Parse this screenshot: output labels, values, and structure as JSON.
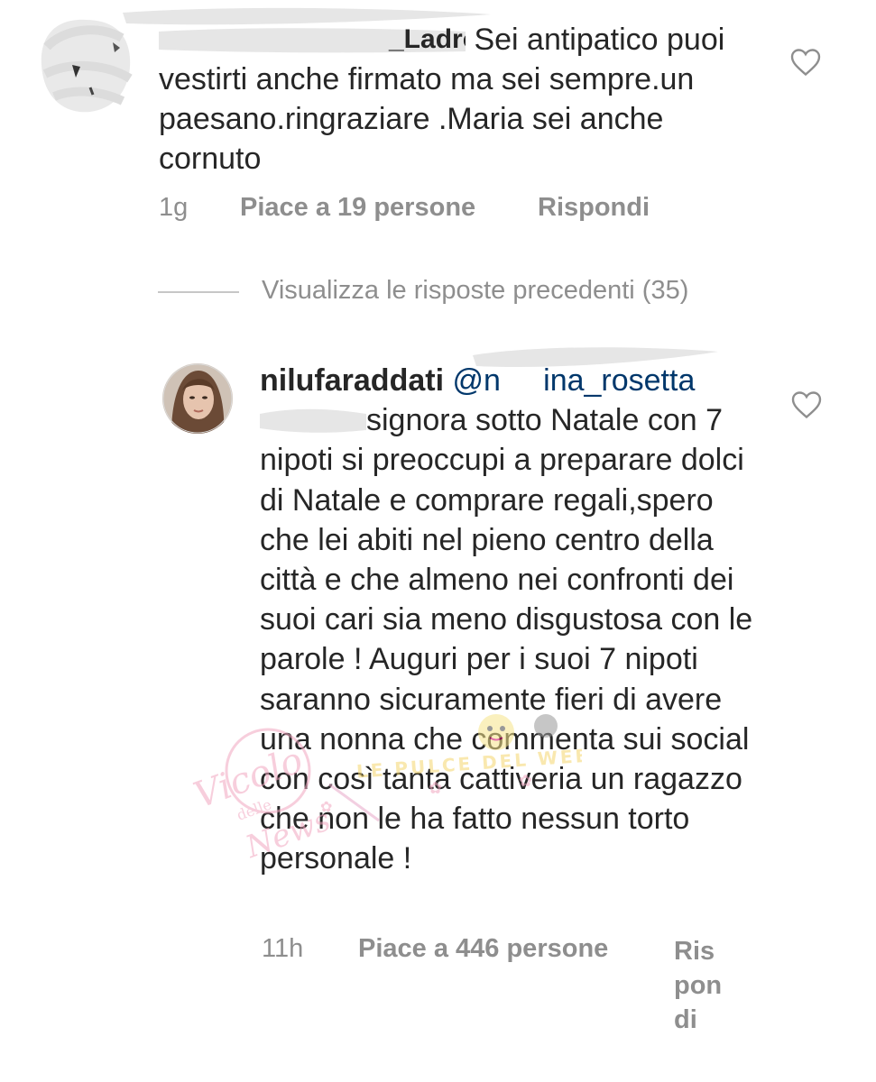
{
  "comment1": {
    "username_suffix": "_Ladro",
    "text": " Sei antipatico puoi vestirti anche firmato ma sei sempre.un paesano.ringraziare .Maria sei anche cornuto",
    "time": "1g",
    "likes": "Piace a 19 persone",
    "reply": "Rispondi"
  },
  "view_previous": "Visualizza le risposte precedenti (35)",
  "comment2": {
    "username": "nilufaraddati",
    "mention": "@n     ina_rosetta",
    "text": "signora sotto Natale con 7 nipoti si preoccupi a preparare dolci di Natale e comprare regali,spero che lei abiti nel pieno centro della città e che almeno nei confronti dei suoi cari sia meno disgustosa con le parole ! Auguri per i suoi 7 nipoti saranno sicuramente fieri di avere una nonna che commenta sui social con così tanta cattiveria un ragazzo che non le ha fatto nessun torto personale !",
    "time": "11h",
    "likes": "Piace a 446 persone",
    "reply": "Rispondi"
  },
  "watermark": {
    "script": "Vicolo delle News",
    "tagline": "Le Pulce del Web"
  },
  "icons": {
    "like": "heart-outline-icon",
    "avatar1": "avatar-scribbled",
    "avatar2": "avatar-photo"
  },
  "colors": {
    "text": "#262626",
    "meta": "#8e8e8e",
    "mention": "#00376b",
    "redaction": "#e6e6e6",
    "watermark": "#f2a7c1"
  }
}
